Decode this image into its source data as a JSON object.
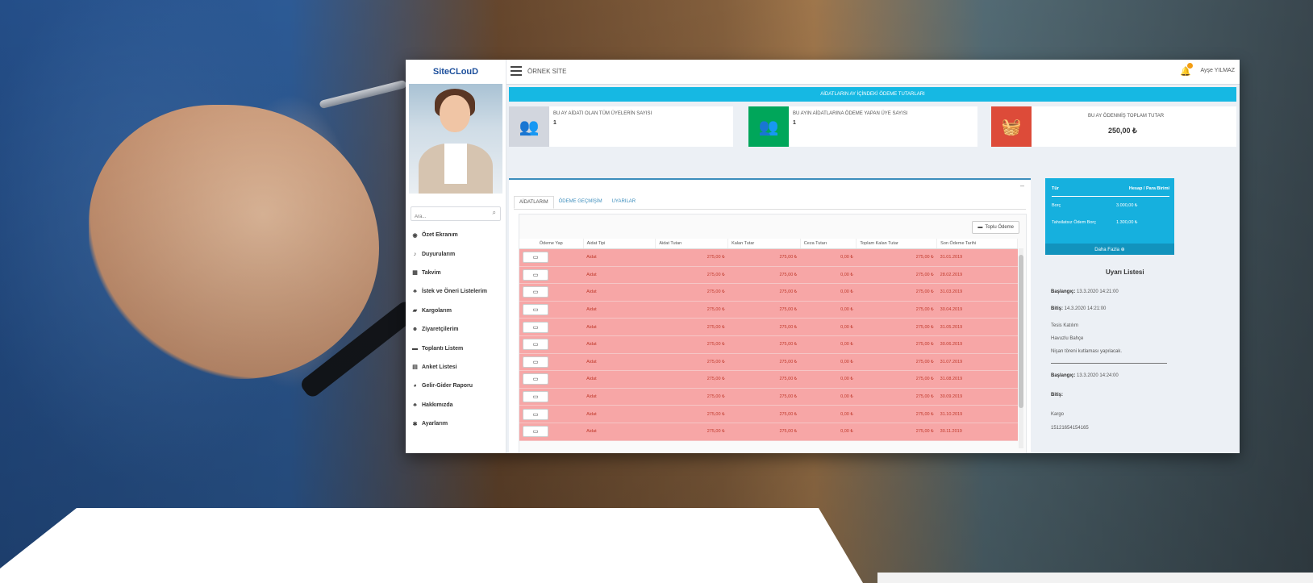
{
  "app": {
    "logo": "SiteCLouD",
    "site_name": "ÖRNEK SİTE",
    "user_name": "Ayşe YILMAZ"
  },
  "sidebar": {
    "search_placeholder": "Ara...",
    "items": [
      {
        "label": "Özet Ekranım",
        "icon": "dashboard-icon"
      },
      {
        "label": "Duyurularım",
        "icon": "bell-icon"
      },
      {
        "label": "Takvim",
        "icon": "calendar-icon"
      },
      {
        "label": "İstek ve Öneri Listelerim",
        "icon": "sitemap-icon"
      },
      {
        "label": "Kargolarım",
        "icon": "truck-icon"
      },
      {
        "label": "Ziyaretçilerim",
        "icon": "users-icon"
      },
      {
        "label": "Toplantı Listem",
        "icon": "list-icon"
      },
      {
        "label": "Anket Listesi",
        "icon": "table-icon"
      },
      {
        "label": "Gelir-Gider Raporu",
        "icon": "chart-icon"
      },
      {
        "label": "Hakkımızda",
        "icon": "sitemap-icon"
      },
      {
        "label": "Ayarlarım",
        "icon": "gear-icon"
      }
    ]
  },
  "banner": "AİDATLARIN AY İÇİNDEKİ ÖDEME TUTARLARI",
  "info_boxes": [
    {
      "label": "BU AY AİDATI OLAN TÜM ÜYELERİN SAYISI",
      "value": "1",
      "color": "#d2d6de",
      "icon": "users-icon"
    },
    {
      "label": "BU AYIN AİDATLARINA ÖDEME YAPAN ÜYE SAYISI",
      "value": "1",
      "color": "#00a65a",
      "icon": "users-icon"
    },
    {
      "label": "BU AY ÖDENMİŞ TOPLAM TUTAR",
      "value": "250,00 ₺",
      "color": "#dd4b39",
      "icon": "basket-icon"
    }
  ],
  "tabs": [
    "AİDATLARIM",
    "ÖDEME GEÇMİŞİM",
    "UYARILAR"
  ],
  "toplu_button": "Toplu Ödeme",
  "table": {
    "headers": [
      "Ödeme Yap",
      "Aidat Tipi",
      "Aidat Tutarı",
      "Kalan Tutar",
      "Ceza Tutarı",
      "Toplam Kalan Tutar",
      "Son Ödeme Tarihi"
    ],
    "rows": [
      {
        "tip": "Aidat",
        "aidat": "275,00 ₺",
        "kalan": "275,00 ₺",
        "ceza": "0,00 ₺",
        "toplam": "275,00 ₺",
        "tarih": "31.01.2019"
      },
      {
        "tip": "Aidat",
        "aidat": "275,00 ₺",
        "kalan": "275,00 ₺",
        "ceza": "0,00 ₺",
        "toplam": "275,00 ₺",
        "tarih": "28.02.2019"
      },
      {
        "tip": "Aidat",
        "aidat": "275,00 ₺",
        "kalan": "275,00 ₺",
        "ceza": "0,00 ₺",
        "toplam": "275,00 ₺",
        "tarih": "31.03.2019"
      },
      {
        "tip": "Aidat",
        "aidat": "275,00 ₺",
        "kalan": "275,00 ₺",
        "ceza": "0,00 ₺",
        "toplam": "275,00 ₺",
        "tarih": "30.04.2019"
      },
      {
        "tip": "Aidat",
        "aidat": "275,00 ₺",
        "kalan": "275,00 ₺",
        "ceza": "0,00 ₺",
        "toplam": "275,00 ₺",
        "tarih": "31.05.2019"
      },
      {
        "tip": "Aidat",
        "aidat": "275,00 ₺",
        "kalan": "275,00 ₺",
        "ceza": "0,00 ₺",
        "toplam": "275,00 ₺",
        "tarih": "30.06.2019"
      },
      {
        "tip": "Aidat",
        "aidat": "275,00 ₺",
        "kalan": "275,00 ₺",
        "ceza": "0,00 ₺",
        "toplam": "275,00 ₺",
        "tarih": "31.07.2019"
      },
      {
        "tip": "Aidat",
        "aidat": "275,00 ₺",
        "kalan": "275,00 ₺",
        "ceza": "0,00 ₺",
        "toplam": "275,00 ₺",
        "tarih": "31.08.2019"
      },
      {
        "tip": "Aidat",
        "aidat": "275,00 ₺",
        "kalan": "275,00 ₺",
        "ceza": "0,00 ₺",
        "toplam": "275,00 ₺",
        "tarih": "30.09.2019"
      },
      {
        "tip": "Aidat",
        "aidat": "275,00 ₺",
        "kalan": "275,00 ₺",
        "ceza": "0,00 ₺",
        "toplam": "275,00 ₺",
        "tarih": "31.10.2019"
      },
      {
        "tip": "Aidat",
        "aidat": "275,00 ₺",
        "kalan": "275,00 ₺",
        "ceza": "0,00 ₺",
        "toplam": "275,00 ₺",
        "tarih": "30.11.2019"
      }
    ]
  },
  "totals_box": {
    "col1_header": "Tür",
    "col2_header": "Hesap / Para Birimi",
    "borc_label": "Borç",
    "borc_value": "3.000,00 ₺",
    "tahsil_label": "Tahsilatsız Ödem Borç",
    "tahsil_value": "1.300,00 ₺",
    "more_label": "Daha Fazla ⊕"
  },
  "uyari": {
    "title": "Uyarı Listesi",
    "items": [
      {
        "baslangic_label": "Başlangıç:",
        "baslangic": "13.3.2020 14:21:00",
        "bitis_label": "Bitiş:",
        "bitis": "14.3.2020 14:21:00",
        "lines": [
          "Tesis Katılım",
          "Havuzlu Bahçe",
          "Nişan töreni kutlaması yapılacak."
        ]
      },
      {
        "baslangic_label": "Başlangıç:",
        "baslangic": "13.3.2020 14:24:00",
        "bitis_label": "Bitiş:",
        "bitis": "",
        "lines": [
          "Kargo",
          "15121654154165"
        ]
      }
    ]
  }
}
